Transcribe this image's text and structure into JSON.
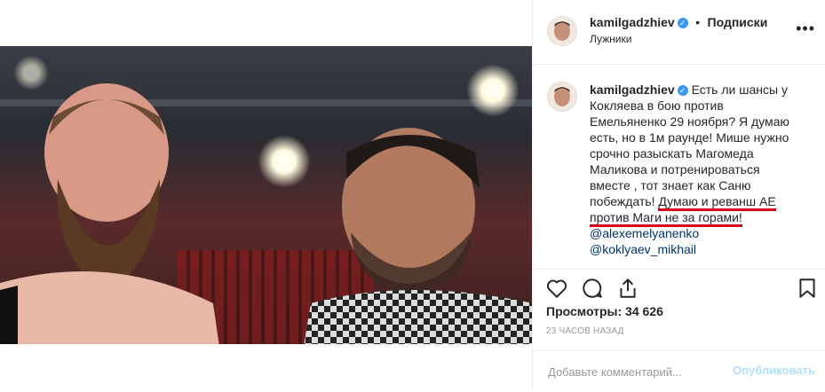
{
  "post": {
    "username": "kamilgadzhiev",
    "follow_label": "Подписки",
    "separator": "•",
    "location": "Лужники",
    "verified_glyph": "✓",
    "caption_lines": [
      "Есть ли шансы у",
      "Кокляева в бою против",
      "Емельяненко 29 ноября? Я думаю",
      "есть, но в 1м раунде! Мише нужно",
      "срочно разыскать Магомеда",
      "Маликова и потренироваться",
      "вместе , тот знает как Саню",
      "побеждать!",
      "Думаю и реванш АЕ",
      "против Маги не за горами!"
    ],
    "mentions": [
      "@alexemelyanenko",
      "@koklyaev_mikhail"
    ],
    "views_label": "Просмотры: 34 626",
    "time_label": "23 ЧАСОВ НАЗАД",
    "comment_placeholder": "Добавьте комментарий...",
    "publish_label": "Опубликовать"
  },
  "icons": [
    "heart-icon",
    "comment-icon",
    "share-icon",
    "bookmark-icon",
    "more-icon",
    "verified-icon"
  ],
  "colors": {
    "accent": "#3897f0",
    "underline": "#d5001c",
    "link": "#003569"
  }
}
